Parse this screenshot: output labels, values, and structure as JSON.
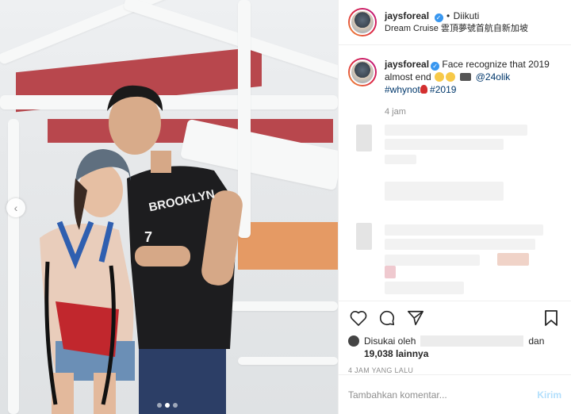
{
  "header": {
    "username": "jaysforeal",
    "verified_mark": "✓",
    "separator": "•",
    "follow_status": "Diikuti",
    "location": "Dream Cruise 雲頂夢號首航自新加坡"
  },
  "caption": {
    "username": "jaysforeal",
    "text": "Face recognize that 2019 almost end",
    "mention": "@24olik",
    "hashtag1": "#whynot",
    "hashtag2": "#2019",
    "time": "4 jam"
  },
  "likes": {
    "prefix": "Disukai oleh",
    "conjunction": "dan",
    "count": "19,038 lainnya"
  },
  "post_time": "4 JAM YANG LALU",
  "comment_box": {
    "placeholder": "Tambahkan komentar...",
    "post_label": "Kirim"
  },
  "carousel": {
    "total": 3,
    "active_index": 2
  },
  "colors": {
    "accent": "#3897f0",
    "link": "#00376b",
    "muted": "#8e8e8e",
    "post_disabled": "#b2dffc"
  }
}
